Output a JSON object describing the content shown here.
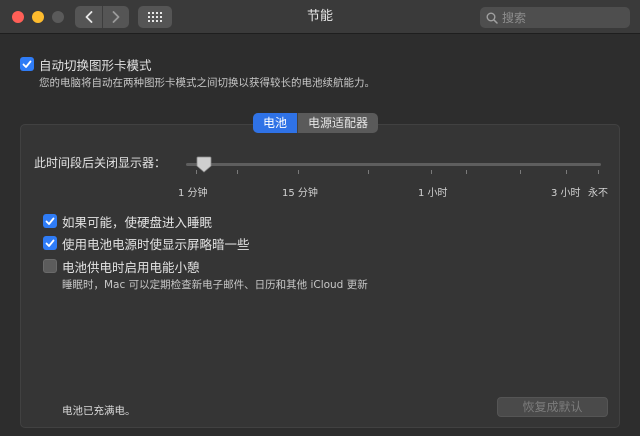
{
  "window": {
    "title": "节能",
    "search_placeholder": "搜索"
  },
  "auto_switch": {
    "label": "自动切换图形卡模式",
    "checked": true,
    "description": "您的电脑将自动在两种图形卡模式之间切换以获得较长的电池续航能力。"
  },
  "tabs": [
    {
      "label": "电池",
      "active": true
    },
    {
      "label": "电源适配器",
      "active": false
    }
  ],
  "display_sleep": {
    "label": "此时间段后关闭显示器：",
    "value": "1 分钟",
    "ticks": [
      "1 分钟",
      "15 分钟",
      "1 小时",
      "3 小时",
      "永不"
    ]
  },
  "options": [
    {
      "label": "如果可能，使硬盘进入睡眠",
      "checked": true
    },
    {
      "label": "使用电池电源时使显示屏略暗一些",
      "checked": true
    },
    {
      "label": "电池供电时启用电能小憩",
      "checked": false,
      "description": "睡眠时，Mac 可以定期检查新电子邮件、日历和其他 iCloud 更新"
    }
  ],
  "status": "电池已充满电。",
  "restore_button": "恢复成默认",
  "colors": {
    "accent": "#2f7cf6",
    "window_bg": "#2d2d2d",
    "titlebar_bg": "#3a3a3a"
  }
}
